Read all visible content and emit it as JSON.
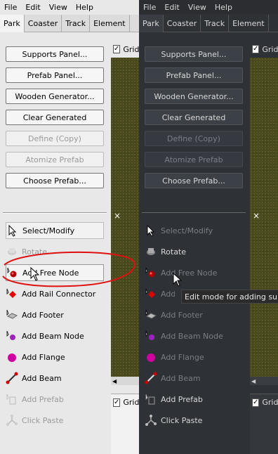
{
  "menu": {
    "file": "File",
    "edit": "Edit",
    "view": "View",
    "help": "Help"
  },
  "tabs": [
    "Park",
    "Coaster",
    "Track",
    "Element"
  ],
  "buttons": [
    "Supports Panel...",
    "Prefab Panel...",
    "Wooden Generator...",
    "Clear Generated",
    "Define (Copy)",
    "Atomize Prefab",
    "Choose Prefab..."
  ],
  "tools": [
    "Select/Modify",
    "Rotate",
    "Add Free Node",
    "Add Rail Connector",
    "Add Footer",
    "Add Beam Node",
    "Add Flange",
    "Add Beam",
    "Add Prefab",
    "Click Paste"
  ],
  "viewport": {
    "grid_label": "Grid",
    "checked": "✓"
  },
  "tooltip": "Edit mode for adding supp",
  "light_theme": {
    "bg": "#e8e8e8",
    "btn": "#f0f0f0",
    "text": "#000000",
    "disabled": "#9a9a9a"
  },
  "dark_theme": {
    "bg": "#2e3136",
    "btn": "#3c4047",
    "text": "#d8d8d8",
    "disabled": "#7a7e85"
  },
  "annotation_color": "#e01010"
}
